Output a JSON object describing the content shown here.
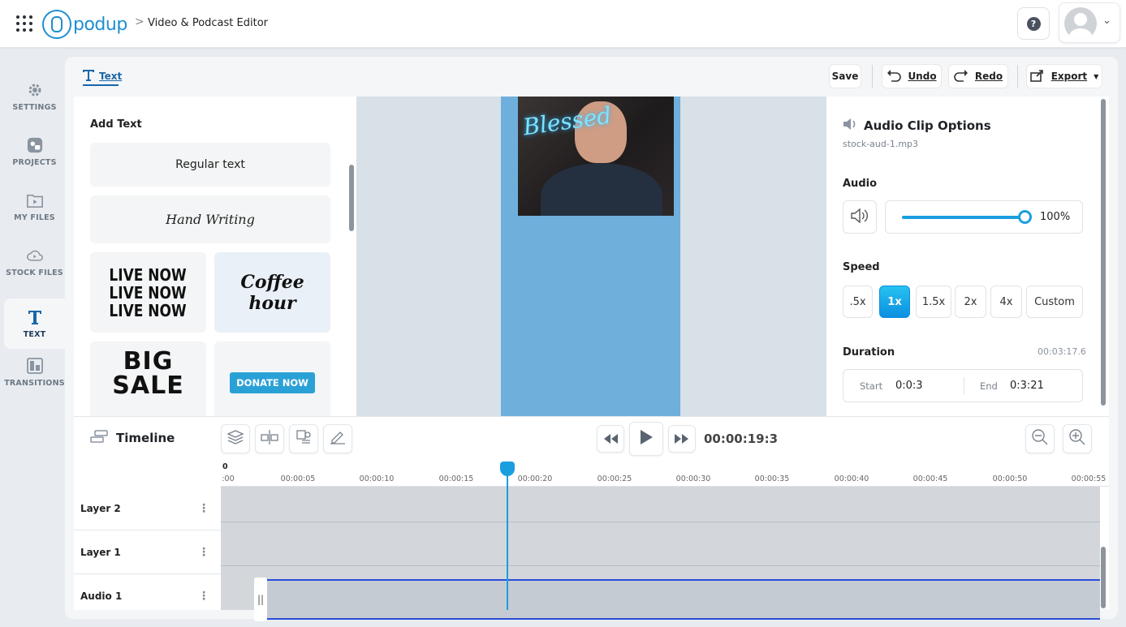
{
  "app": {
    "logo_text": "podup",
    "breadcrumb_separator": ">",
    "page_title": "Video & Podcast Editor"
  },
  "header": {
    "help_label": "?"
  },
  "sidebar": {
    "items": [
      {
        "label": "SETTINGS",
        "icon": "gear-icon"
      },
      {
        "label": "PROJECTS",
        "icon": "projects-icon"
      },
      {
        "label": "MY FILES",
        "icon": "folder-play-icon"
      },
      {
        "label": "STOCK FILES",
        "icon": "cloud-play-icon"
      },
      {
        "label": "TEXT",
        "icon": "text-icon",
        "active": true
      },
      {
        "label": "TRANSITIONS",
        "icon": "transitions-icon"
      }
    ]
  },
  "toolbar": {
    "active_tab": "Text",
    "save_label": "Save",
    "undo_label": "Undo",
    "redo_label": "Redo",
    "export_label": "Export"
  },
  "text_panel": {
    "title": "Add Text",
    "presets": {
      "regular": "Regular text",
      "handwriting": "Hand Writing",
      "live_now": [
        "LIVE NOW",
        "LIVE NOW",
        "LIVE NOW"
      ],
      "coffee": [
        "Coffee",
        "hour"
      ],
      "big_sale": [
        "BIG",
        "SALE"
      ],
      "donate": "DONATE NOW"
    }
  },
  "canvas": {
    "neon_text": "Blessed"
  },
  "audio_options": {
    "title": "Audio Clip Options",
    "file_name": "stock-aud-1.mp3",
    "audio_label": "Audio",
    "volume": "100%",
    "volume_fraction": 1.0,
    "speed_label": "Speed",
    "speed_options": [
      ".5x",
      "1x",
      "1.5x",
      "2x",
      "4x",
      "Custom"
    ],
    "speed_selected": "1x",
    "duration_label": "Duration",
    "duration_total": "00:03:17.6",
    "start_label": "Start",
    "start_value": "0:0:3",
    "end_label": "End",
    "end_value": "0:3:21"
  },
  "timeline": {
    "title": "Timeline",
    "current_time": "00:00:19:3",
    "ruler_zero": "0",
    "ruler_ticks": [
      ":00",
      "00:00:05",
      "00:00:10",
      "00:00:15",
      "00:00:20",
      "00:00:25",
      "00:00:30",
      "00:00:35",
      "00:00:40",
      "00:00:45",
      "00:00:50",
      "00:00:55"
    ],
    "tracks": [
      {
        "name": "Layer 2"
      },
      {
        "name": "Layer 1"
      },
      {
        "name": "Audio 1"
      }
    ],
    "clip_handle": "||"
  },
  "colors": {
    "accent": "#1a9ee0",
    "canvas_page": "#6fafdc",
    "clip_border": "#2a4dd8"
  }
}
